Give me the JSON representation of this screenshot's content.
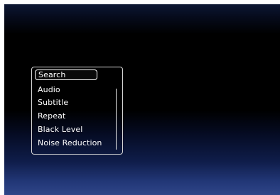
{
  "menu": {
    "items": [
      {
        "label": "Search",
        "selected": true
      },
      {
        "label": "Audio"
      },
      {
        "label": "Subtitle"
      },
      {
        "label": "Repeat"
      },
      {
        "label": "Black Level"
      },
      {
        "label": "Noise Reduction"
      }
    ]
  },
  "colors": {
    "background_top": "#0c1733",
    "background_mid": "#000000",
    "background_bottom": "#2f4588",
    "menu_text": "#ffffff",
    "menu_border": "#d8d8d8"
  }
}
